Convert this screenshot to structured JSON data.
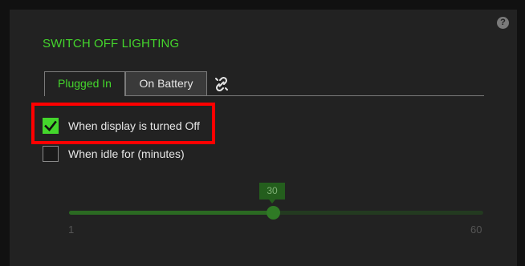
{
  "section": {
    "title": "SWITCH OFF LIGHTING",
    "help_label": "?"
  },
  "tabs": [
    {
      "label": "Plugged In",
      "active": true
    },
    {
      "label": "On Battery",
      "active": false
    }
  ],
  "link_icon": "unlink-icon",
  "options": [
    {
      "label": "When display is turned Off",
      "checked": true
    },
    {
      "label": "When idle for (minutes)",
      "checked": false
    }
  ],
  "slider": {
    "value": "30",
    "min": "1",
    "max": "60"
  },
  "colors": {
    "accent": "#44d62c",
    "highlight": "#ff0000",
    "panel": "#222222"
  }
}
